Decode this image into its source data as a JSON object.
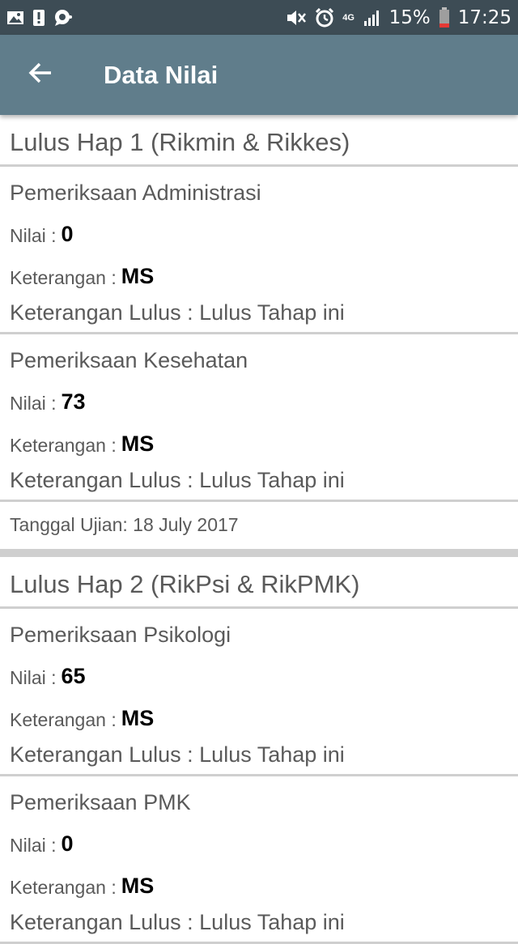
{
  "status_bar": {
    "battery": "15%",
    "time": "17:25",
    "network": "4G",
    "left_icons": [
      "gallery-icon",
      "alert-icon",
      "chat-icon"
    ],
    "right_icons": [
      "mute-icon",
      "alarm-icon",
      "network-4g-icon",
      "signal-icon",
      "battery-icon"
    ]
  },
  "app_bar": {
    "title": "Data Nilai",
    "background": "#607d8b"
  },
  "stages": [
    {
      "title": "Lulus Hap 1 (Rikmin & Rikkes)",
      "exams": [
        {
          "name": "Pemeriksaan Administrasi",
          "nilai_label": "Nilai :",
          "nilai": "0",
          "keterangan_label": "Keterangan :",
          "keterangan": "MS",
          "lulus": "Keterangan Lulus : Lulus Tahap ini"
        },
        {
          "name": "Pemeriksaan Kesehatan",
          "nilai_label": "Nilai :",
          "nilai": "73",
          "keterangan_label": "Keterangan :",
          "keterangan": "MS",
          "lulus": "Keterangan Lulus : Lulus Tahap ini"
        }
      ],
      "tanggal": "Tanggal Ujian: 18 July 2017"
    },
    {
      "title": "Lulus Hap 2 (RikPsi & RikPMK)",
      "exams": [
        {
          "name": "Pemeriksaan Psikologi",
          "nilai_label": "Nilai :",
          "nilai": "65",
          "keterangan_label": "Keterangan :",
          "keterangan": "MS",
          "lulus": "Keterangan Lulus : Lulus Tahap ini"
        },
        {
          "name": "Pemeriksaan PMK",
          "nilai_label": "Nilai :",
          "nilai": "0",
          "keterangan_label": "Keterangan :",
          "keterangan": "MS",
          "lulus": "Keterangan Lulus : Lulus Tahap ini"
        }
      ]
    }
  ]
}
